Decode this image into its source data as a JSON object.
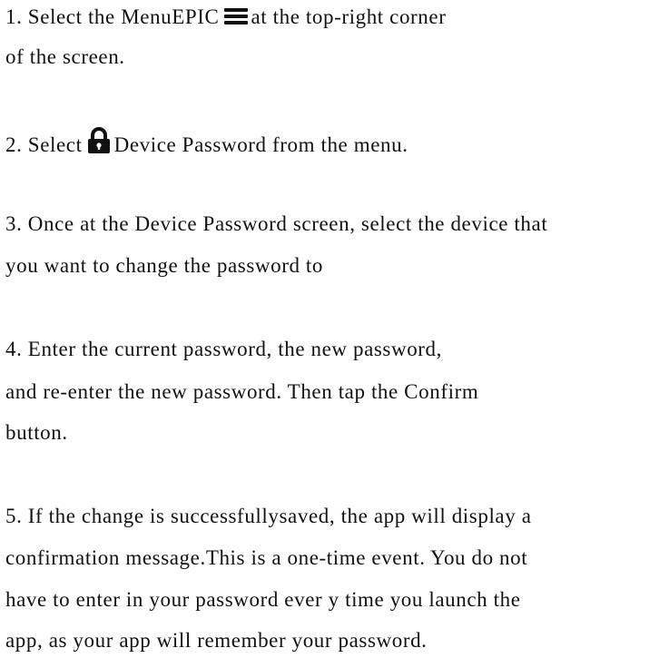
{
  "step1": {
    "before_icon": "1. Select the MenuEPIC",
    "icon": "hamburger-menu-icon",
    "after_icon": "at the top-right corner",
    "line2": "of the screen."
  },
  "step2": {
    "before_icon": "2. Select",
    "icon": "lock-icon",
    "after_icon": "Device Password from the menu."
  },
  "step3": {
    "line1": "3. Once at the Device Password screen, select the device that",
    "line2": "you want to change the password to"
  },
  "step4": {
    "line1": "4. Enter the current password, the new password,",
    "line2": "and re-enter the new password. Then tap the Confirm",
    "line3": "button."
  },
  "step5": {
    "line1": "5. If the change is successfullysaved, the app will display a",
    "line2": "confirmation message.This is a one-time event. You do not",
    "line3": "have to enter in your password ever y time you launch the",
    "line4": "app, as your app will remember your password."
  }
}
